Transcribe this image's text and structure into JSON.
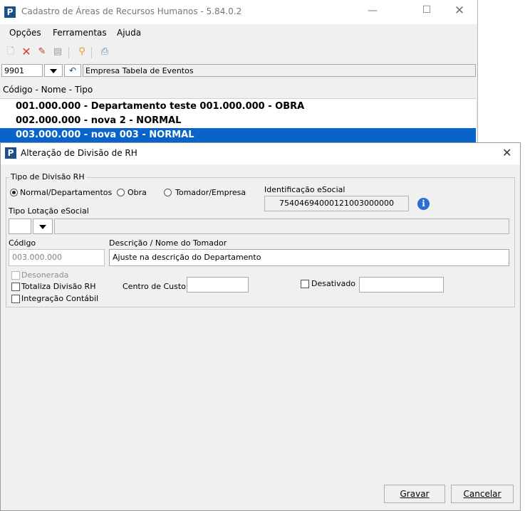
{
  "main_window": {
    "title": "Cadastro de Áreas de Recursos Humanos - 5.84.0.2",
    "menu": [
      "Opções",
      "Ferramentas",
      "Ajuda"
    ],
    "company_code": "9901",
    "company_name": "Empresa Tabela de Eventos",
    "list_header": "Código - Nome - Tipo",
    "rows": [
      "001.000.000 - Departamento teste 001.000.000 - OBRA",
      "002.000.000 - nova 2 - NORMAL",
      "003.000.000 - nova 003 - NORMAL"
    ],
    "selected_row_index": 2
  },
  "dialog": {
    "title": "Alteração de Divisão de RH",
    "group_label": "Tipo de Divisão RH",
    "radio_options": [
      "Normal/Departamentos",
      "Obra",
      "Tomador/Empresa"
    ],
    "radio_selected_index": 0,
    "esocial_label": "Identificação eSocial",
    "esocial_value": "75404694000121003000000",
    "tipo_lotacao_label": "Tipo Lotação eSocial",
    "codigo_label": "Código",
    "codigo_value": "003.000.000",
    "descricao_label": "Descrição / Nome do Tomador",
    "descricao_value": "Ajuste na descrição do Departamento",
    "desonerada_label": "Desonerada",
    "totaliza_label": "Totaliza Divisão RH",
    "integracao_label": "Integração Contábil",
    "centro_custo_label": "Centro de Custo",
    "centro_custo_value": "",
    "desativado_label": "Desativado",
    "desativado_value": "",
    "gravar_label": "Gravar",
    "cancelar_label": "Cancelar"
  },
  "colors": {
    "selection": "#0a63c8",
    "brand": "#1b4f8a",
    "delete_red": "#e03a2f",
    "info_blue": "#2a6fd1"
  }
}
